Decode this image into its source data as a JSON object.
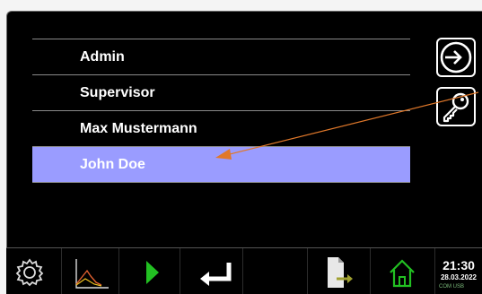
{
  "users": {
    "items": [
      {
        "label": "Admin",
        "selected": false
      },
      {
        "label": "Supervisor",
        "selected": false
      },
      {
        "label": "Max Mustermann",
        "selected": false
      },
      {
        "label": "John Doe",
        "selected": true
      }
    ],
    "selected_color": "#9a9cff"
  },
  "side_buttons": {
    "login_icon": "login-arrow-icon",
    "password_icon": "key-icon"
  },
  "annotation": {
    "color": "#e0782a"
  },
  "toolbar": {
    "items": [
      {
        "icon": "gear-icon"
      },
      {
        "icon": "chart-icon"
      },
      {
        "icon": "play-icon",
        "color": "#22c022"
      },
      {
        "icon": "enter-icon"
      },
      {
        "icon": "file-export-icon",
        "color": "#a0a030"
      },
      {
        "icon": "home-icon",
        "color": "#22c022"
      }
    ]
  },
  "clock": {
    "time": "21:30",
    "date": "28.03.2022",
    "extra": "COM USB"
  }
}
